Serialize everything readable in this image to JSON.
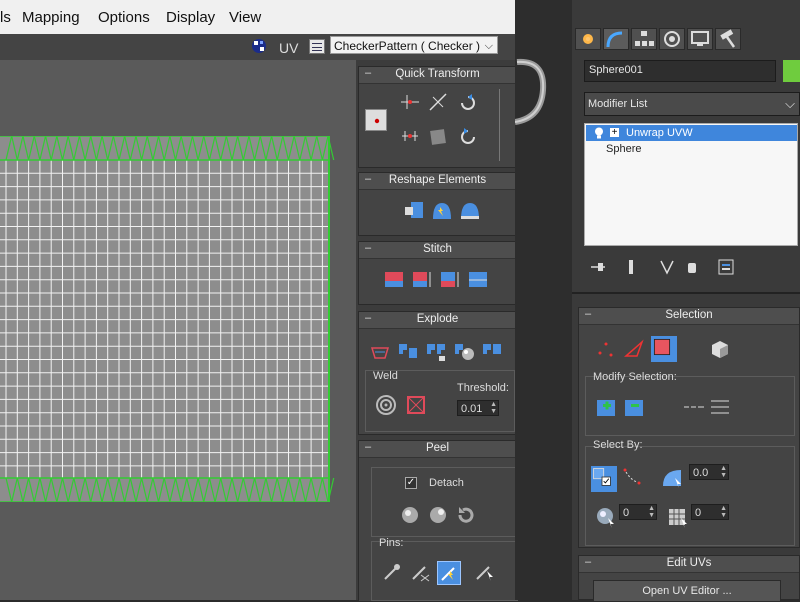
{
  "menubar": {
    "items": [
      "ls",
      "Mapping",
      "Options",
      "Display",
      "View"
    ]
  },
  "uv_toolbar": {
    "uv_label": "UV",
    "texture_select": "CheckerPattern  ( Checker )"
  },
  "rollouts": {
    "quick_transform": {
      "title": "Quick Transform"
    },
    "reshape_elements": {
      "title": "Reshape Elements"
    },
    "stitch": {
      "title": "Stitch"
    },
    "explode": {
      "title": "Explode",
      "weld_label": "Weld",
      "threshold_label": "Threshold:",
      "threshold_value": "0.01"
    },
    "peel": {
      "title": "Peel",
      "detach_label": "Detach",
      "detach_checked": true,
      "pins_label": "Pins:"
    }
  },
  "command_panel": {
    "object_name": "Sphere001",
    "object_color": "#6fcc3e",
    "modifier_list_label": "Modifier List",
    "stack": [
      {
        "label": "Unwrap UVW",
        "selected": true
      },
      {
        "label": "Sphere",
        "selected": false
      }
    ],
    "selection": {
      "title": "Selection",
      "modify_selection_label": "Modify Selection:",
      "select_by_label": "Select By:",
      "spinner1_value": "0.0",
      "spinner2_value": "0",
      "spinner3_value": "0"
    },
    "edit_uvs": {
      "title": "Edit UVs",
      "open_editor_label": "Open UV Editor ..."
    }
  },
  "colors": {
    "accent_blue": "#3f86dc",
    "grid_green": "#33cc33"
  }
}
